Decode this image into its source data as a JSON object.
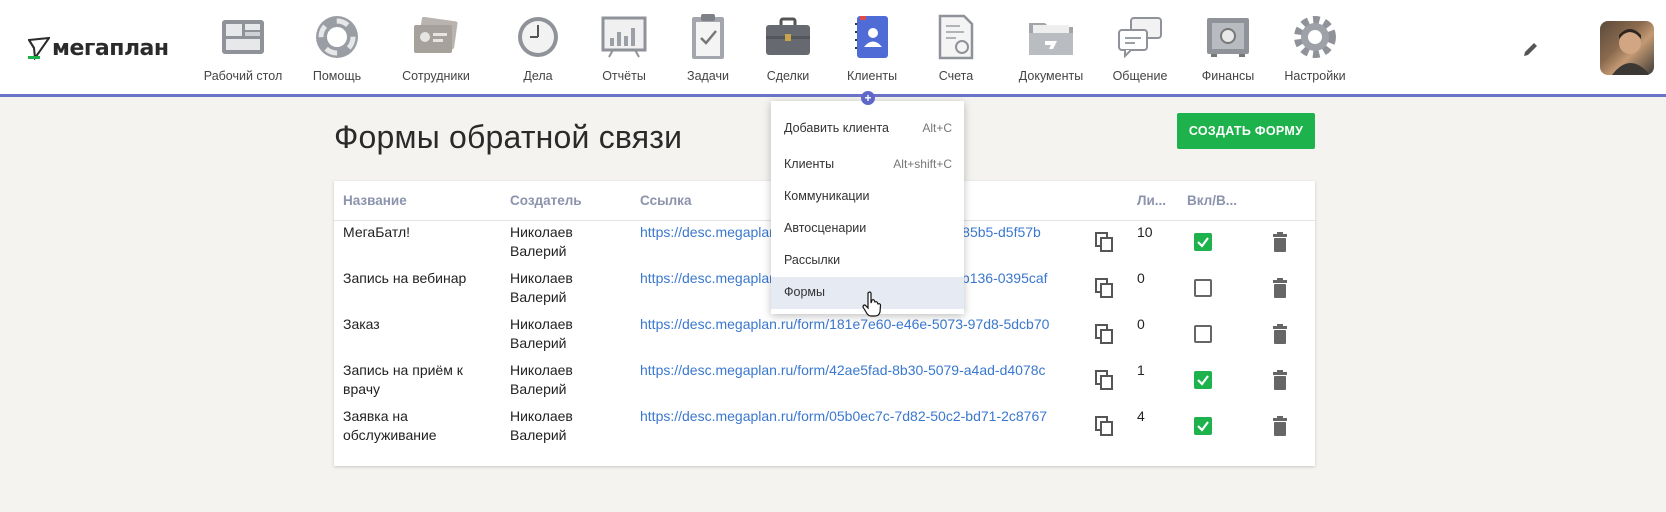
{
  "app": {
    "logo_text": "мегаплан"
  },
  "nav": {
    "items": [
      {
        "label": "Рабочий стол",
        "icon": "desktop-icon"
      },
      {
        "label": "Помощь",
        "icon": "lifebuoy-icon"
      },
      {
        "label": "Сотрудники",
        "icon": "employees-icon"
      },
      {
        "label": "Дела",
        "icon": "clock-icon"
      },
      {
        "label": "Отчёты",
        "icon": "chart-board-icon"
      },
      {
        "label": "Задачи",
        "icon": "clipboard-icon"
      },
      {
        "label": "Сделки",
        "icon": "briefcase-icon"
      },
      {
        "label": "Клиенты",
        "icon": "contacts-book-icon"
      },
      {
        "label": "Счета",
        "icon": "invoice-icon"
      },
      {
        "label": "Документы",
        "icon": "folder-icon"
      },
      {
        "label": "Общение",
        "icon": "chat-icon"
      },
      {
        "label": "Финансы",
        "icon": "safe-icon"
      },
      {
        "label": "Настройки",
        "icon": "gear-icon"
      }
    ]
  },
  "page": {
    "title": "Формы обратной связи",
    "create_button": "СОЗДАТЬ ФОРМУ"
  },
  "table": {
    "headers": {
      "name": "Название",
      "creator": "Создатель",
      "link": "Ссылка",
      "leads": "Ли...",
      "enabled": "Вкл/В..."
    },
    "rows": [
      {
        "name": "МегаБатл!",
        "creator": "Николаев Валерий",
        "link": "https://desc.megaplan.ru/form/c4a1d7b2-1f3e-5a4c-85b5-d5f57b",
        "leads": "10",
        "enabled": true
      },
      {
        "name": "Запись на вебинар",
        "creator": "Николаев Валерий",
        "link": "https://desc.megaplan.ru/form/9be02c11-4d5a-5e7f-b136-0395caf",
        "leads": "0",
        "enabled": false
      },
      {
        "name": "Заказ",
        "creator": "Николаев Валерий",
        "link": "https://desc.megaplan.ru/form/181e7e60-e46e-5073-97d8-5dcb70",
        "leads": "0",
        "enabled": false
      },
      {
        "name": "Запись на приём к врачу",
        "creator": "Николаев Валерий",
        "link": "https://desc.megaplan.ru/form/42ae5fad-8b30-5079-a4ad-d4078c",
        "leads": "1",
        "enabled": true
      },
      {
        "name": "Заявка на обслуживание",
        "creator": "Николаев Валерий",
        "link": "https://desc.megaplan.ru/form/05b0ec7c-7d82-50c2-bd71-2c8767",
        "leads": "4",
        "enabled": true
      }
    ]
  },
  "dropdown": {
    "items": [
      {
        "label": "Добавить клиента",
        "shortcut": "Alt+C"
      },
      {
        "label": "Клиенты",
        "shortcut": "Alt+shift+C"
      },
      {
        "label": "Коммуникации",
        "shortcut": ""
      },
      {
        "label": "Автосценарии",
        "shortcut": ""
      },
      {
        "label": "Рассылки",
        "shortcut": ""
      },
      {
        "label": "Формы",
        "shortcut": "",
        "active": true
      }
    ]
  },
  "colors": {
    "accent": "#6b72c9",
    "primary_button": "#1db24c",
    "link": "#3a78cf",
    "header_text": "#8b93ad",
    "background": "#f4f3ef"
  }
}
